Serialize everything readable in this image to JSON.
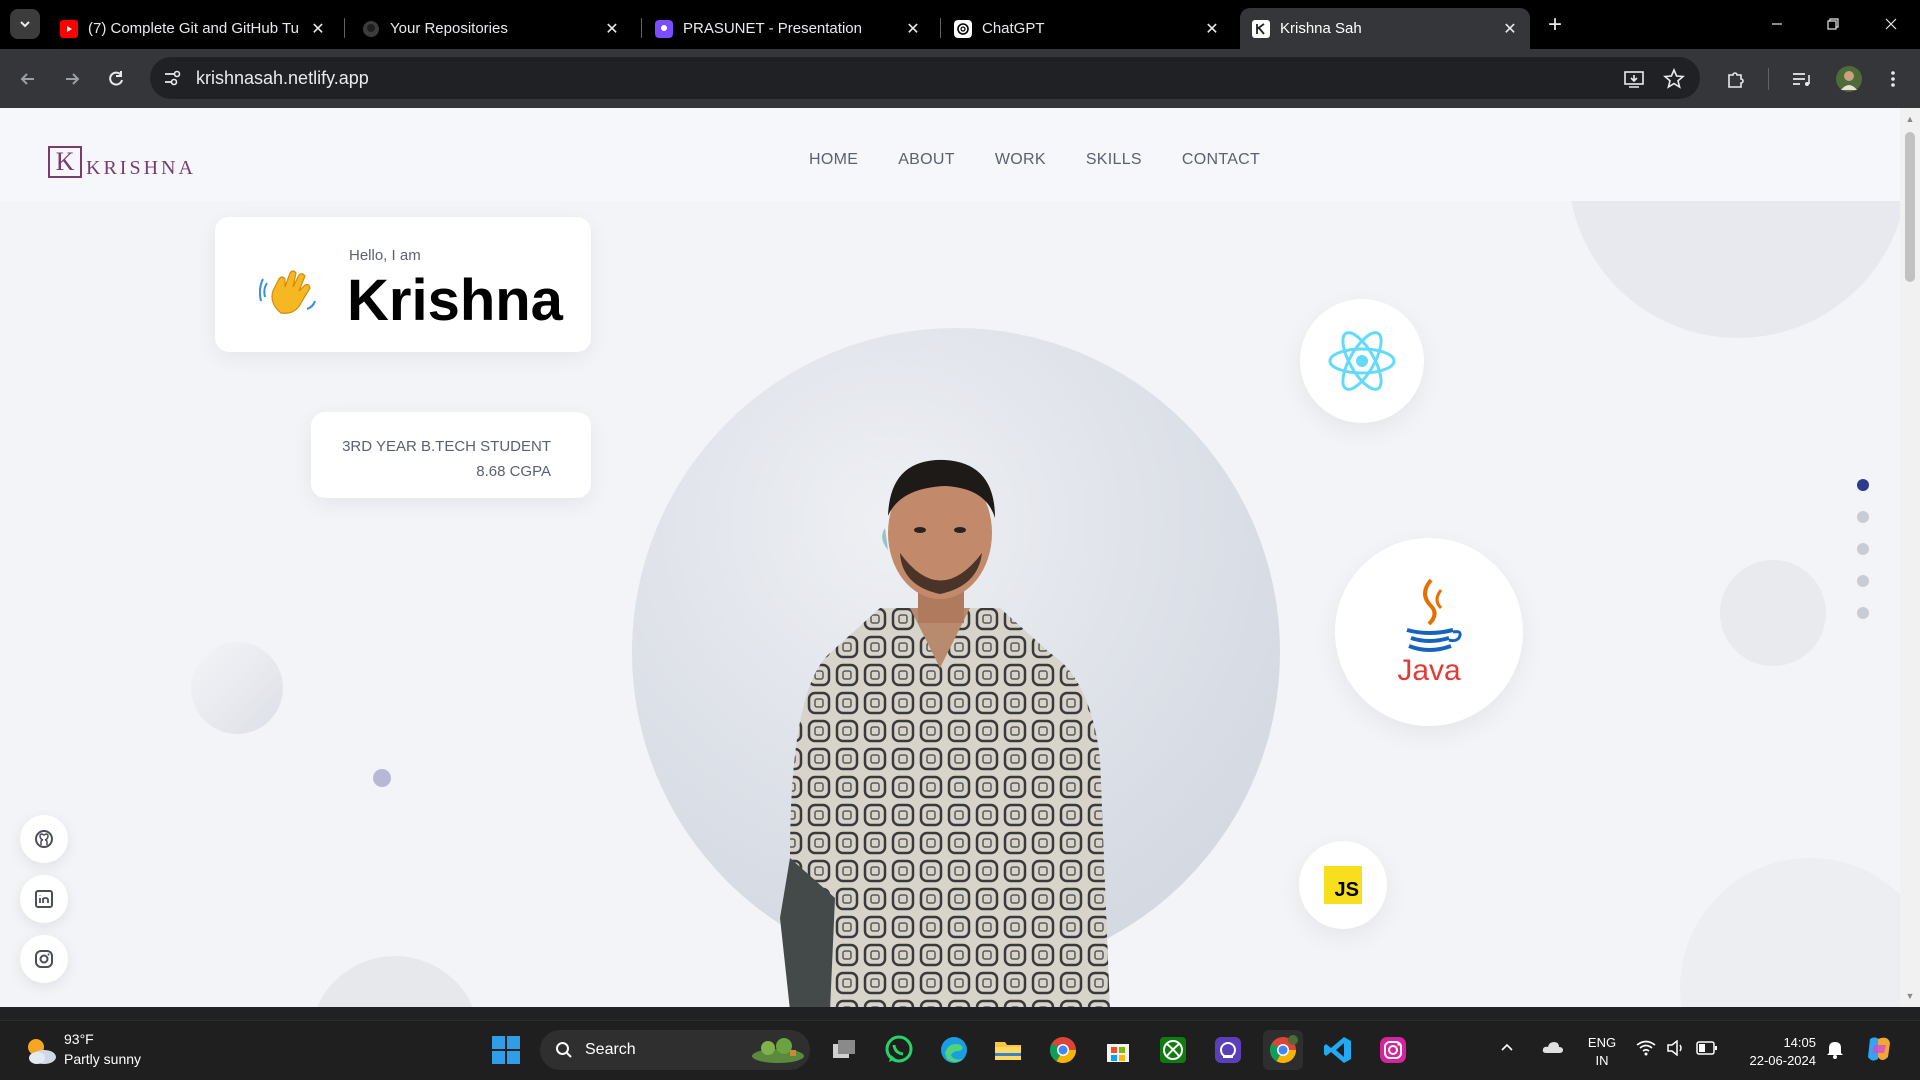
{
  "browser": {
    "tabs": [
      {
        "title": "(7) Complete Git and GitHub Tu",
        "active": false
      },
      {
        "title": "Your Repositories",
        "active": false
      },
      {
        "title": "PRASUNET - Presentation",
        "active": false
      },
      {
        "title": "ChatGPT",
        "active": false
      },
      {
        "title": "Krishna Sah",
        "active": true
      }
    ],
    "url": "krishnasah.netlify.app"
  },
  "site": {
    "logo_letter": "K",
    "logo_text": "KRISHNA",
    "nav": [
      "HOME",
      "ABOUT",
      "WORK",
      "SKILLS",
      "CONTACT"
    ],
    "greeting": "Hello, I am",
    "name": "Krishna",
    "student_line1": "3RD YEAR B.TECH STUDENT",
    "student_line2": "8.68 CGPA",
    "skills": [
      {
        "name": "react-icon"
      },
      {
        "name": "java-icon",
        "label": "Java"
      },
      {
        "name": "javascript-icon",
        "label": "JS"
      }
    ],
    "section_dots": 5,
    "active_section": 0,
    "socials": [
      "github-icon",
      "linkedin-icon",
      "instagram-icon"
    ]
  },
  "taskbar": {
    "weather_temp": "93°F",
    "weather_desc": "Partly sunny",
    "search_label": "Search",
    "lang_line1": "ENG",
    "lang_line2": "IN",
    "time": "14:05",
    "date": "22-06-2024"
  },
  "colors": {
    "accent": "#7a3b6e",
    "active_dot": "#2b3a8c",
    "page_bg": "#f2f4f8"
  }
}
